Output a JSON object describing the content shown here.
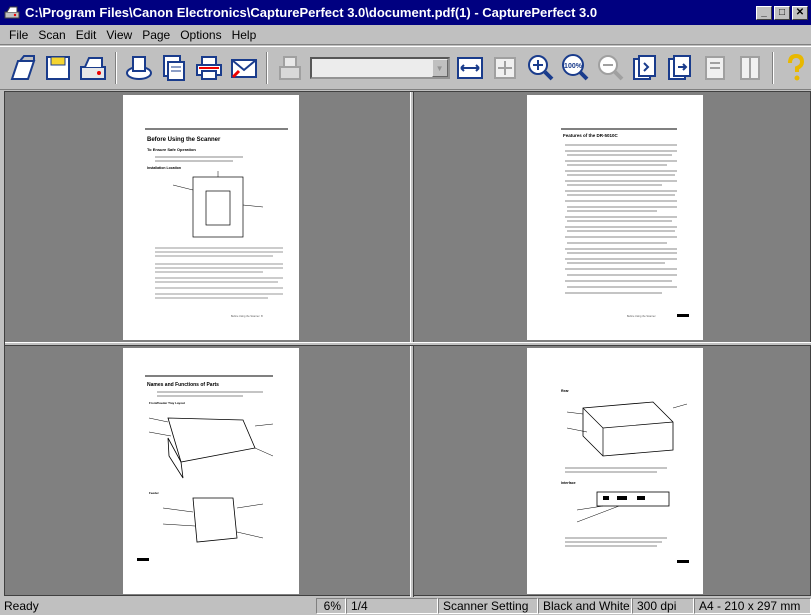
{
  "window": {
    "title": "C:\\Program Files\\Canon Electronics\\CapturePerfect 3.0\\document.pdf(1) - CapturePerfect 3.0",
    "icon": "scanner-app-icon",
    "controls": [
      "minimize",
      "maximize",
      "close"
    ]
  },
  "menu": {
    "items": [
      "File",
      "Scan",
      "Edit",
      "View",
      "Page",
      "Options",
      "Help"
    ]
  },
  "toolbar": {
    "buttons": [
      "open-icon",
      "save-icon",
      "scan-icon",
      "scan-batch-icon",
      "scan-to-file-icon",
      "scan-to-print-icon",
      "scan-to-mail-icon",
      "scanner-setting-icon",
      "fit-width-icon",
      "fit-page-icon",
      "zoom-in-icon",
      "zoom-100-icon",
      "zoom-out-icon",
      "page-prev-icon",
      "page-next-icon",
      "rotate-icon",
      "thumbnail-icon",
      "help-icon"
    ],
    "combo_value": "",
    "zoom_100_label": "100%"
  },
  "pages": [
    {
      "title": "Before Using the Scanner",
      "subheading": "To Ensure Safe Operation",
      "section": "Installation Location",
      "footer": "Before Using the Scanner",
      "page_num": "8"
    },
    {
      "title": "Features of the DR-5010C",
      "footer": "Before Using the Scanner"
    },
    {
      "title": "Names and Functions of Parts",
      "section": "Front/Feeder Tray Layout",
      "section2": "Feeder"
    },
    {
      "section": "Rear",
      "section2": "Interface"
    }
  ],
  "status": {
    "ready": "Ready",
    "zoom": "6%",
    "page": "1/4",
    "scanner_setting": "Scanner Setting",
    "color_mode": "Black and White",
    "dpi": "300 dpi",
    "paper": "A4 - 210 x 297 mm"
  }
}
